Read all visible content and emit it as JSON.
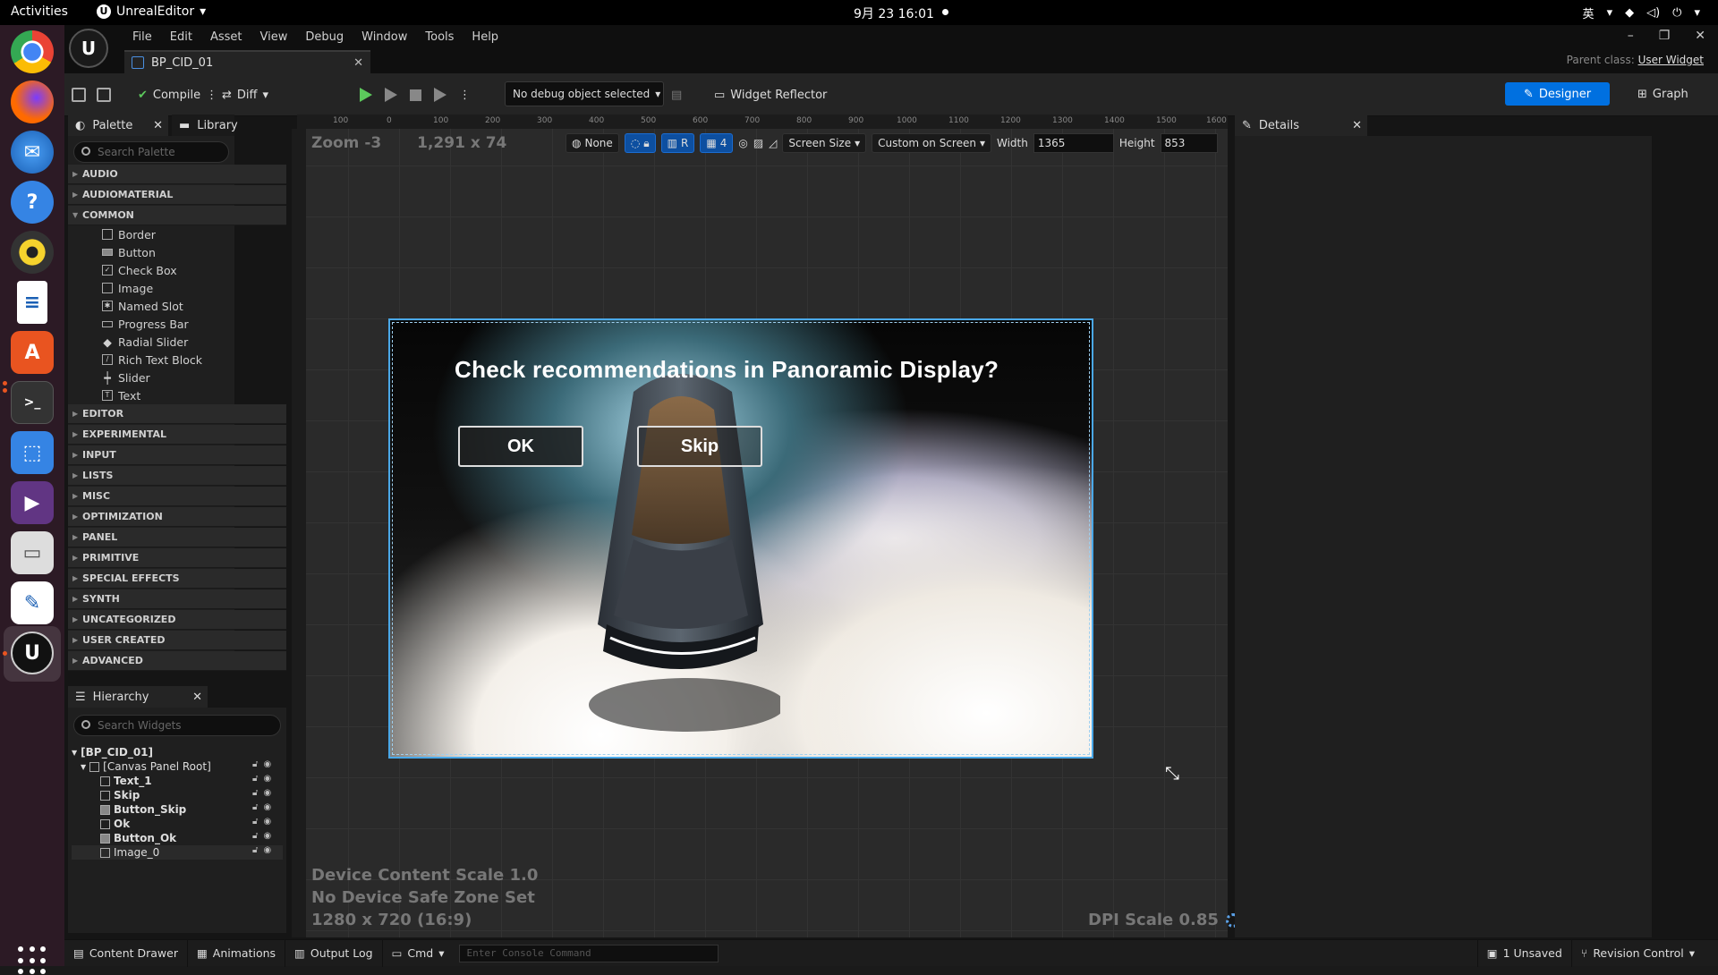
{
  "system": {
    "activities": "Activities",
    "app_name": "UnrealEditor",
    "clock": "9月 23  16:01",
    "ime": "英"
  },
  "editor": {
    "menus": [
      "File",
      "Edit",
      "Asset",
      "View",
      "Debug",
      "Window",
      "Tools",
      "Help"
    ],
    "doc_tab": "BP_CID_01",
    "parent_class_label": "Parent class:",
    "parent_class_value": "User Widget",
    "toolbar": {
      "compile": "Compile",
      "diff": "Diff",
      "debug_object": "No debug object selected",
      "widget_reflector": "Widget Reflector",
      "designer": "Designer",
      "graph": "Graph"
    }
  },
  "palette": {
    "tab_palette": "Palette",
    "tab_library": "Library",
    "search_placeholder": "Search Palette",
    "categories_top": [
      "AUDIO",
      "AUDIOMATERIAL",
      "COMMON"
    ],
    "common_items": [
      "Border",
      "Button",
      "Check Box",
      "Image",
      "Named Slot",
      "Progress Bar",
      "Radial Slider",
      "Rich Text Block",
      "Slider",
      "Text"
    ],
    "categories_bottom": [
      "EDITOR",
      "EXPERIMENTAL",
      "INPUT",
      "LISTS",
      "MISC",
      "OPTIMIZATION",
      "PANEL",
      "PRIMITIVE",
      "SPECIAL EFFECTS",
      "SYNTH",
      "UNCATEGORIZED",
      "USER CREATED",
      "ADVANCED"
    ]
  },
  "hierarchy": {
    "tab": "Hierarchy",
    "search_placeholder": "Search Widgets",
    "root": "[BP_CID_01]",
    "canvas": "[Canvas Panel Root]",
    "children": [
      "Text_1",
      "Skip",
      "Button_Skip",
      "Ok",
      "Button_Ok",
      "Image_0"
    ]
  },
  "canvas": {
    "zoom": "Zoom -3",
    "dims": "1,291 x 74",
    "ruler": [
      "100",
      "0",
      "100",
      "200",
      "300",
      "400",
      "500",
      "600",
      "700",
      "800",
      "900",
      "1000",
      "1100",
      "1200",
      "1300",
      "1400",
      "1500",
      "1600"
    ],
    "tools": {
      "none": "None",
      "r": "R",
      "grid_num": "4",
      "screen_size": "Screen Size",
      "custom_on_screen": "Custom on Screen",
      "width_label": "Width",
      "width_value": "1365",
      "height_label": "Height",
      "height_value": "853"
    },
    "dialog_title": "Check recommendations in Panoramic Display?",
    "ok_label": "OK",
    "skip_label": "Skip",
    "device_content_scale": "Device Content Scale 1.0",
    "safe_zone": "No Device Safe Zone Set",
    "resolution": "1280 x 720 (16:9)",
    "dpi_scale": "DPI Scale 0.85"
  },
  "details": {
    "tab": "Details"
  },
  "statusbar": {
    "content_drawer": "Content Drawer",
    "animations": "Animations",
    "output_log": "Output Log",
    "cmd": "Cmd",
    "console_placeholder": "Enter Console Command",
    "unsaved": "1 Unsaved",
    "revision_control": "Revision Control"
  },
  "colors": {
    "accent": "#0070e0",
    "selection_border": "#4aa8e8",
    "ubuntu_orange": "#e95420"
  }
}
